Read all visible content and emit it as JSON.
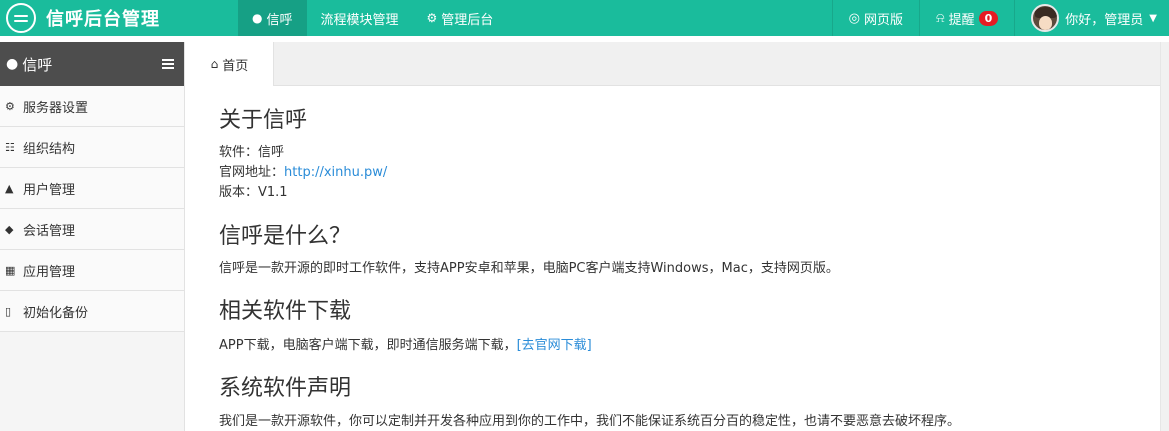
{
  "app": {
    "title": "信呼后台管理",
    "logo_icon": "chat-bubble-icon"
  },
  "topnav": {
    "items": [
      {
        "label": "信呼",
        "icon": "comment-icon",
        "active": true
      },
      {
        "label": "流程模块管理",
        "icon": "",
        "active": false
      },
      {
        "label": "管理后台",
        "icon": "gear-icon",
        "active": false
      }
    ]
  },
  "rightnav": {
    "web": {
      "label": "网页版",
      "icon": "globe-icon"
    },
    "remind": {
      "label": "提醒",
      "icon": "bell-icon",
      "count": "0"
    },
    "user": {
      "greeting": "你好，管理员",
      "icon": "caret-down-icon"
    }
  },
  "sidebar": {
    "title": "信呼",
    "items": [
      {
        "label": "服务器设置",
        "icon": "gear-icon"
      },
      {
        "label": "组织结构",
        "icon": "sitemap-icon"
      },
      {
        "label": "用户管理",
        "icon": "user-icon"
      },
      {
        "label": "会话管理",
        "icon": "comments-icon"
      },
      {
        "label": "应用管理",
        "icon": "grid-icon"
      },
      {
        "label": "初始化备份",
        "icon": "bookmark-icon"
      }
    ]
  },
  "tabs": [
    {
      "label": "首页",
      "icon": "home-icon",
      "active": true
    }
  ],
  "content": {
    "about_title": "关于信呼",
    "software_line": "软件：信呼",
    "site_label": "官网地址：",
    "site_url": "http://xinhu.pw/",
    "version_line": "版本：V1.1",
    "what_title": "信呼是什么？",
    "what_text": "信呼是一款开源的即时工作软件，支持APP安卓和苹果，电脑PC客户端支持Windows，Mac，支持网页版。",
    "download_title": "相关软件下载",
    "download_text": "APP下载，电脑客户端下载，即时通信服务端下载，",
    "download_link": "[去官网下载]",
    "statement_title": "系统软件声明",
    "statement_text": "我们是一款开源软件，你可以定制并开发各种应用到你的工作中，我们不能保证系统百分百的稳定性，也请不要恶意去破坏程序。"
  },
  "colors": {
    "accent": "#1abc9c",
    "accent_dark": "#16a085",
    "sidebar_head": "#4d4d4d",
    "link": "#2a8cd8",
    "badge": "#e51c23"
  }
}
